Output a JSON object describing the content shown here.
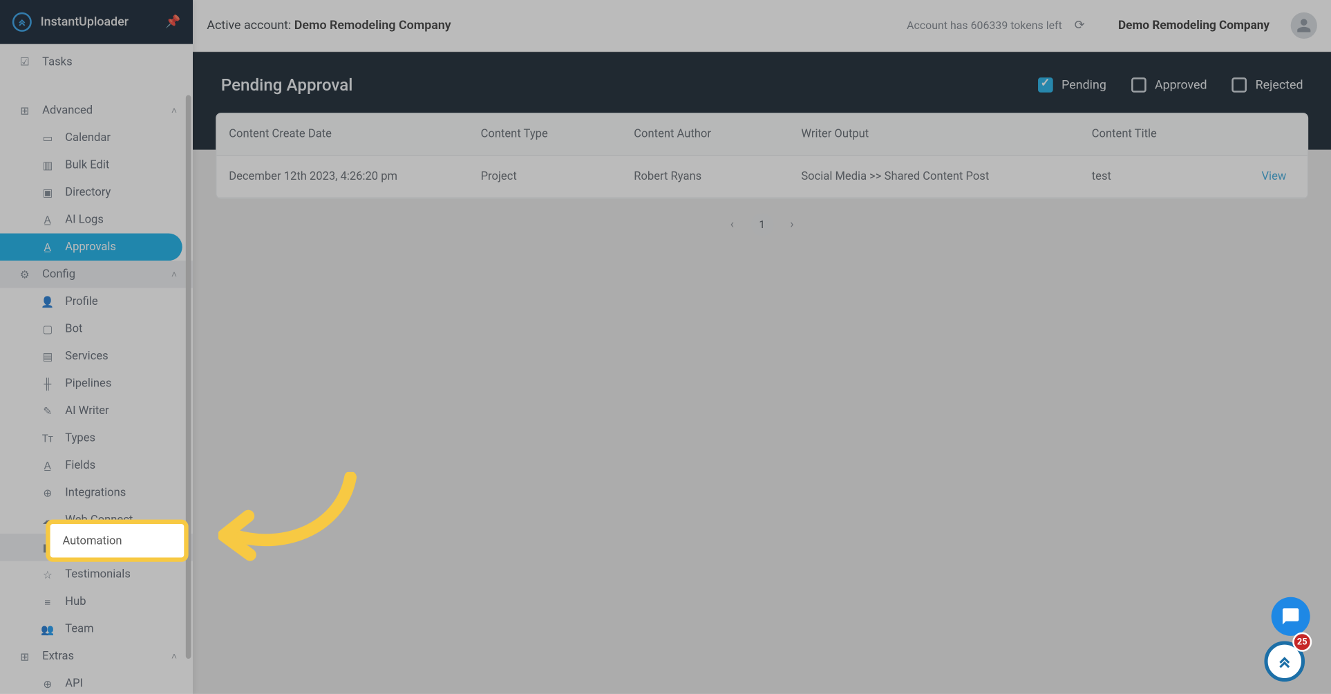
{
  "app": {
    "name": "InstantUploader"
  },
  "sidebar": {
    "top_items": [
      {
        "label": "Tasks",
        "icon": "☑"
      }
    ],
    "groups": {
      "advanced": {
        "label": "Advanced",
        "items": [
          {
            "label": "Calendar"
          },
          {
            "label": "Bulk Edit"
          },
          {
            "label": "Directory"
          },
          {
            "label": "AI Logs"
          },
          {
            "label": "Approvals",
            "active": true
          }
        ]
      },
      "config": {
        "label": "Config",
        "items": [
          {
            "label": "Profile"
          },
          {
            "label": "Bot"
          },
          {
            "label": "Services"
          },
          {
            "label": "Pipelines"
          },
          {
            "label": "AI Writer"
          },
          {
            "label": "Types"
          },
          {
            "label": "Fields"
          },
          {
            "label": "Integrations"
          },
          {
            "label": "Web Connect"
          },
          {
            "label": "Automation",
            "highlight": true
          },
          {
            "label": "Testimonials"
          },
          {
            "label": "Hub"
          },
          {
            "label": "Team"
          }
        ]
      },
      "extras": {
        "label": "Extras",
        "items": [
          {
            "label": "API"
          }
        ]
      }
    }
  },
  "topbar": {
    "active_account_prefix": "Active account: ",
    "active_account_name": "Demo Remodeling Company",
    "tokens_text": "Account has 606339 tokens left",
    "company_name": "Demo Remodeling Company"
  },
  "page": {
    "title": "Pending Approval",
    "filters": {
      "pending": "Pending",
      "approved": "Approved",
      "rejected": "Rejected",
      "pending_checked": true,
      "approved_checked": false,
      "rejected_checked": false
    }
  },
  "table": {
    "headers": {
      "date": "Content Create Date",
      "type": "Content Type",
      "author": "Content Author",
      "output": "Writer Output",
      "title": "Content Title"
    },
    "rows": [
      {
        "date": "December 12th 2023, 4:26:20 pm",
        "type": "Project",
        "author": "Robert Ryans",
        "output": "Social Media >> Shared Content Post",
        "title": "test",
        "action": "View"
      }
    ],
    "page_number": "1"
  },
  "highlight": {
    "label": "Automation"
  },
  "badge": {
    "count": "25"
  }
}
